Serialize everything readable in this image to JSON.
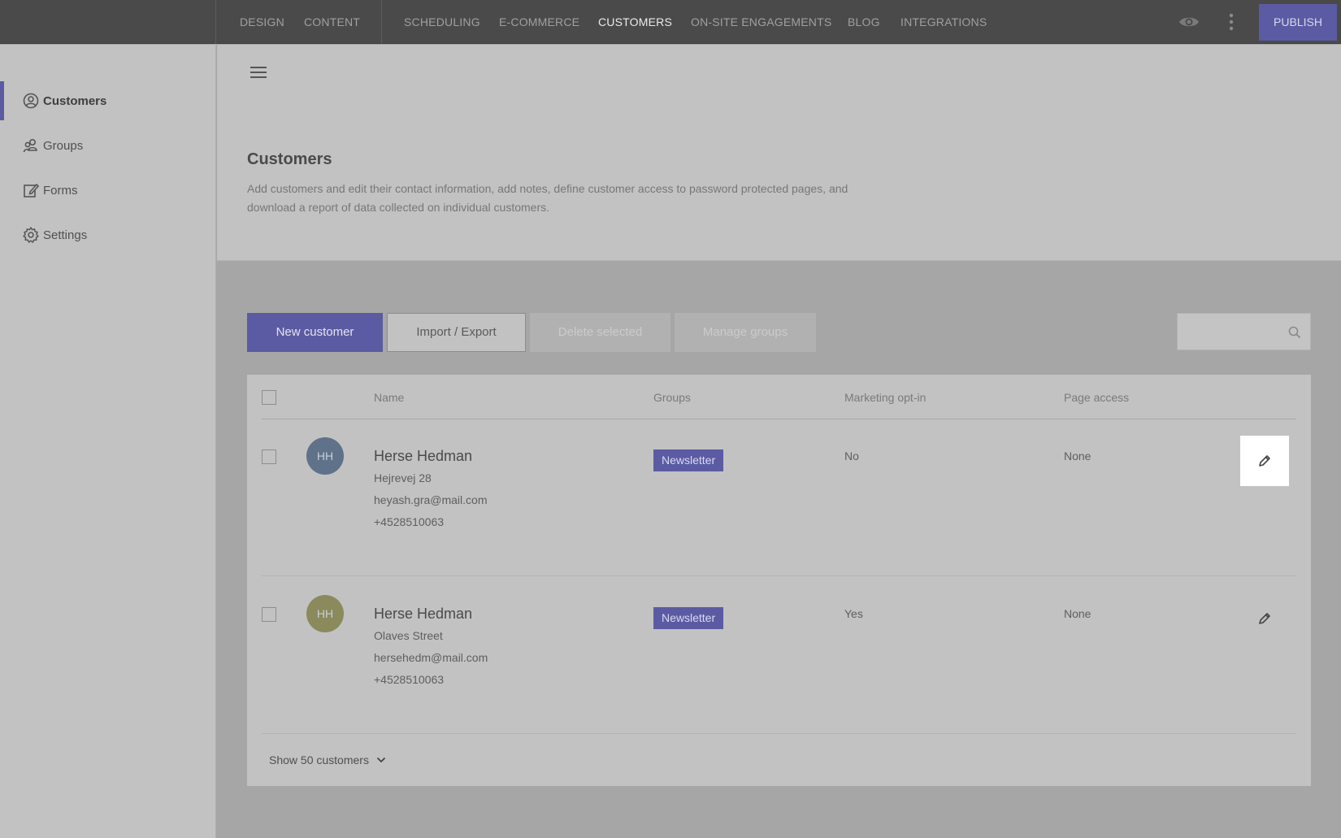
{
  "topnav": {
    "items": [
      "DESIGN",
      "CONTENT",
      "SCHEDULING",
      "E-COMMERCE",
      "CUSTOMERS",
      "ON-SITE ENGAGEMENTS",
      "BLOG",
      "INTEGRATIONS"
    ],
    "active": "CUSTOMERS",
    "publish_label": "PUBLISH"
  },
  "sidebar": {
    "items": [
      {
        "label": "Customers",
        "icon": "user-circle-icon",
        "active": true
      },
      {
        "label": "Groups",
        "icon": "users-group-icon"
      },
      {
        "label": "Forms",
        "icon": "form-edit-icon"
      },
      {
        "label": "Settings",
        "icon": "gear-icon"
      }
    ]
  },
  "header": {
    "title": "Customers",
    "description": "Add customers and edit their contact information, add notes, define customer access to password protected pages, and download a report of data collected on individual customers."
  },
  "toolbar": {
    "new_customer": "New customer",
    "import_export": "Import / Export",
    "delete_selected": "Delete selected",
    "manage_groups": "Manage groups",
    "search_placeholder": ""
  },
  "table": {
    "columns": [
      "Name",
      "Groups",
      "Marketing opt-in",
      "Page access"
    ],
    "rows": [
      {
        "initials": "HH",
        "avatar_color": "#5f7289",
        "name": "Herse Hedman",
        "address": "Hejrevej 28",
        "email": "heyash.gra@mail.com",
        "phone": "+4528510063",
        "group": "Newsletter",
        "opt_in": "No",
        "page_access": "None"
      },
      {
        "initials": "HH",
        "avatar_color": "#8a8a5c",
        "name": "Herse Hedman",
        "address": "Olaves Street",
        "email": "hersehedm@mail.com",
        "phone": "+4528510063",
        "group": "Newsletter",
        "opt_in": "Yes",
        "page_access": "None"
      }
    ],
    "show_more": "Show 50 customers"
  },
  "colors": {
    "accent": "#5b5ba3",
    "topbar": "#4a4a4a",
    "overlay_bg": "#a6a6a6"
  }
}
